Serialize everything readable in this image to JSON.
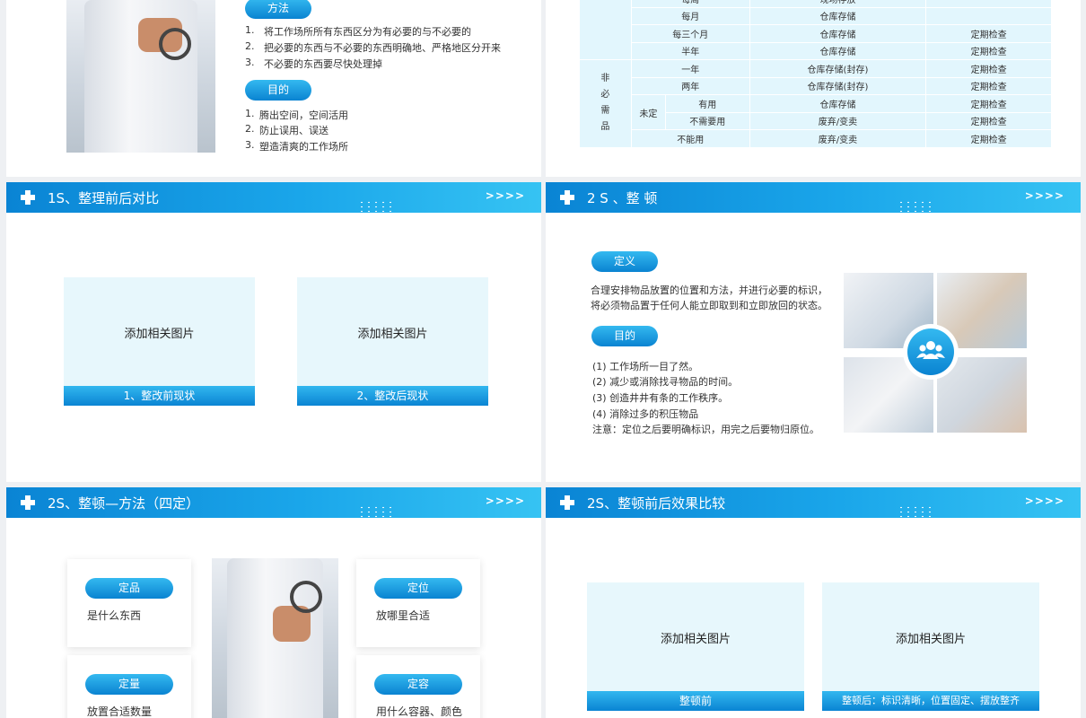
{
  "slide1": {
    "method_label": "方法",
    "method_items": [
      "将工作场所所有东西区分为有必要的与不必要的",
      "把必要的东西与不必要的东西明确地、严格地区分开来",
      "不必要的东西要尽快处理掉"
    ],
    "method_nums": [
      "1.",
      "2.",
      "3."
    ],
    "purpose_label": "目的",
    "purpose_items": [
      "腾出空间，空间活用",
      "防止误用、误送",
      "塑造清爽的工作场所"
    ],
    "purpose_nums": [
      "1.",
      "2.",
      "3."
    ]
  },
  "slide2": {
    "group_label": "非必需品",
    "sub_label": "未定",
    "rows": [
      {
        "freq": "每周",
        "method": "现场存放",
        "check": ""
      },
      {
        "freq": "每月",
        "method": "仓库存储",
        "check": ""
      },
      {
        "freq": "每三个月",
        "method": "仓库存储",
        "check": "定期检查"
      },
      {
        "freq": "半年",
        "method": "仓库存储",
        "check": "定期检查"
      },
      {
        "freq": "一年",
        "method": "仓库存储(封存)",
        "check": "定期检查"
      },
      {
        "freq": "两年",
        "method": "仓库存储(封存)",
        "check": "定期检查"
      },
      {
        "freq": "有用",
        "method": "仓库存储",
        "check": "定期检查"
      },
      {
        "freq": "不需要用",
        "method": "废弃/变卖",
        "check": "定期检查"
      },
      {
        "freq": "不能用",
        "method": "废弃/变卖",
        "check": "定期检查"
      }
    ]
  },
  "slide3": {
    "title": "1S、整理前后对比",
    "arrows": ">>>>",
    "placeholder": "添加相关图片",
    "caption_before": "1、整改前现状",
    "caption_after": "2、整改后现状"
  },
  "slide4": {
    "title": "2 S 、整 顿",
    "arrows": ">>>>",
    "definition_label": "定义",
    "definition_lines": [
      "合理安排物品放置的位置和方法，并进行必要的标识，",
      "将必须物品置于任何人能立即取到和立即放回的状态。"
    ],
    "purpose_label": "目的",
    "purpose_items": [
      "(1)  工作场所一目了然。",
      "(2)  减少或消除找寻物品的时间。",
      "(3)  创造井井有条的工作秩序。",
      "(4)  消除过多的积压物品"
    ],
    "note": "注意：定位之后要明确标识，用完之后要物归原位。"
  },
  "slide5": {
    "title": "2S、整顿—方法（四定）",
    "arrows": ">>>>",
    "cards": [
      {
        "label": "定品",
        "text": "是什么东西"
      },
      {
        "label": "定位",
        "text": "放哪里合适"
      },
      {
        "label": "定量",
        "text": "放置合适数量"
      },
      {
        "label": "定容",
        "text": "用什么容器、颜色"
      }
    ]
  },
  "slide6": {
    "title": "2S、整顿前后效果比较",
    "arrows": ">>>>",
    "placeholder": "添加相关图片",
    "caption_before": "整顿前",
    "caption_after": "整顿后：标识清晰，位置固定、摆放整齐"
  }
}
